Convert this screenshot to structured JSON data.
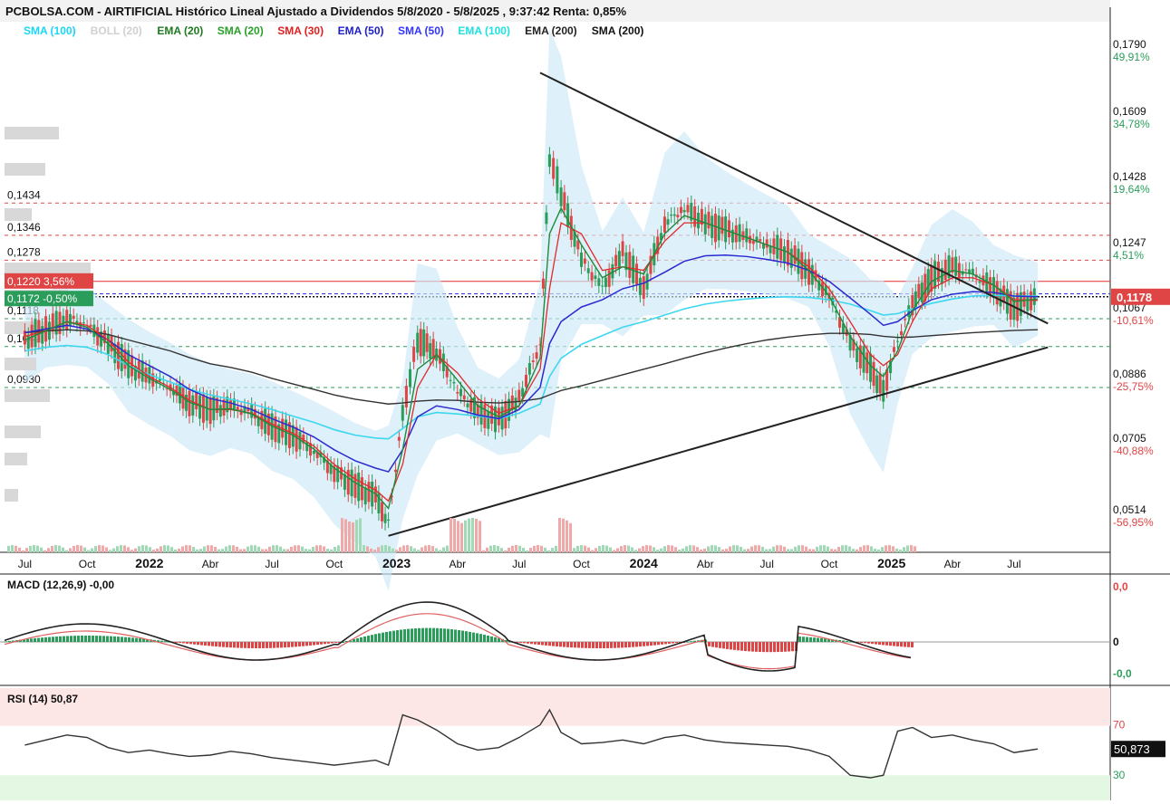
{
  "title": "PCBOLSA.COM - AIRTIFICIAL Histórico Lineal Ajustado a Dividendos 5/8/2020 - 5/8/2025 , 9:37:42 Renta: 0,85%",
  "legend": [
    {
      "label": "SMA (100)",
      "color": "#1ad7f7"
    },
    {
      "label": "BOLL (20)",
      "color": "#d0d0d0"
    },
    {
      "label": "EMA (20)",
      "color": "#1f7a1f"
    },
    {
      "label": "SMA (20)",
      "color": "#2aa02a"
    },
    {
      "label": "SMA (30)",
      "color": "#e02020"
    },
    {
      "label": "EMA (50)",
      "color": "#2020c8"
    },
    {
      "label": "SMA (50)",
      "color": "#3434ff"
    },
    {
      "label": "EMA (100)",
      "color": "#20e0e0"
    },
    {
      "label": "EMA (200)",
      "color": "#222222"
    },
    {
      "label": "SMA (200)",
      "color": "#111111"
    }
  ],
  "price_axis": [
    {
      "price": "0,1790",
      "pct": "49,91%",
      "pct_color": "#2a9d5a"
    },
    {
      "price": "0,1609",
      "pct": "34,78%",
      "pct_color": "#2a9d5a"
    },
    {
      "price": "0,1428",
      "pct": "19,64%",
      "pct_color": "#2a9d5a"
    },
    {
      "price": "0,1247",
      "pct": "4,51%",
      "pct_color": "#2a9d5a"
    },
    {
      "price": "0,1067",
      "pct": "-10,61%",
      "pct_color": "#e04545"
    },
    {
      "price": "0,0886",
      "pct": "-25,75%",
      "pct_color": "#e04545"
    },
    {
      "price": "0,0705",
      "pct": "-40,88%",
      "pct_color": "#e04545"
    },
    {
      "price": "0,0514",
      "pct": "-56,95%",
      "pct_color": "#e04545"
    }
  ],
  "current_price": "0,1178",
  "left_levels": [
    {
      "value": 0.1434,
      "text": "0,1434"
    },
    {
      "value": 0.1346,
      "text": "0,1346"
    },
    {
      "value": 0.1278,
      "text": "0,1278"
    },
    {
      "value": 0.1118,
      "text": "0,1118"
    },
    {
      "value": 0.1042,
      "text": "0,1042"
    },
    {
      "value": 0.093,
      "text": "0,0930"
    }
  ],
  "tag_high": {
    "value": 0.122,
    "text": "0,1220",
    "pct": "3,56%"
  },
  "tag_low": {
    "value": 0.1172,
    "text": "0,1172",
    "pct": "-0,50%"
  },
  "time_labels": [
    {
      "date": "2021-07-01",
      "text": "Jul",
      "bold": false
    },
    {
      "date": "2021-10-01",
      "text": "Oct",
      "bold": false
    },
    {
      "date": "2022-01-01",
      "text": "2022",
      "bold": true
    },
    {
      "date": "2022-04-01",
      "text": "Abr",
      "bold": false
    },
    {
      "date": "2022-07-01",
      "text": "Jul",
      "bold": false
    },
    {
      "date": "2022-10-01",
      "text": "Oct",
      "bold": false
    },
    {
      "date": "2023-01-01",
      "text": "2023",
      "bold": true
    },
    {
      "date": "2023-04-01",
      "text": "Abr",
      "bold": false
    },
    {
      "date": "2023-07-01",
      "text": "Jul",
      "bold": false
    },
    {
      "date": "2023-10-01",
      "text": "Oct",
      "bold": false
    },
    {
      "date": "2024-01-01",
      "text": "2024",
      "bold": true
    },
    {
      "date": "2024-04-01",
      "text": "Abr",
      "bold": false
    },
    {
      "date": "2024-07-01",
      "text": "Jul",
      "bold": false
    },
    {
      "date": "2024-10-01",
      "text": "Oct",
      "bold": false
    },
    {
      "date": "2025-01-01",
      "text": "2025",
      "bold": true
    },
    {
      "date": "2025-04-01",
      "text": "Abr",
      "bold": false
    },
    {
      "date": "2025-07-01",
      "text": "Jul",
      "bold": false
    }
  ],
  "macd": {
    "label": "MACD (12,26,9)",
    "value": "-0,00",
    "axis": [
      "0,0",
      "0",
      "-0,0"
    ]
  },
  "rsi": {
    "label": "RSI (14)",
    "value": "50,87",
    "current": "50,873",
    "axis": [
      "70",
      "30"
    ]
  },
  "chart_data": {
    "type": "line",
    "x_type": "date",
    "price": {
      "dates": [
        "2021-07-01",
        "2021-08-01",
        "2021-09-01",
        "2021-10-01",
        "2021-11-01",
        "2021-12-01",
        "2022-01-01",
        "2022-02-01",
        "2022-03-01",
        "2022-04-01",
        "2022-05-01",
        "2022-06-01",
        "2022-07-01",
        "2022-08-01",
        "2022-09-01",
        "2022-10-01",
        "2022-11-01",
        "2022-12-01",
        "2022-12-20",
        "2023-01-10",
        "2023-02-01",
        "2023-03-01",
        "2023-04-01",
        "2023-05-01",
        "2023-06-01",
        "2023-07-01",
        "2023-08-01",
        "2023-08-15",
        "2023-09-01",
        "2023-10-01",
        "2023-11-01",
        "2023-12-01",
        "2024-01-01",
        "2024-02-01",
        "2024-03-01",
        "2024-04-01",
        "2024-05-01",
        "2024-06-01",
        "2024-07-01",
        "2024-08-01",
        "2024-09-01",
        "2024-10-01",
        "2024-11-01",
        "2024-12-01",
        "2024-12-20",
        "2025-01-10",
        "2025-02-01",
        "2025-03-01",
        "2025-04-01",
        "2025-05-01",
        "2025-06-01",
        "2025-07-01",
        "2025-08-05"
      ],
      "close": [
        0.106,
        0.109,
        0.112,
        0.11,
        0.105,
        0.099,
        0.096,
        0.093,
        0.089,
        0.087,
        0.088,
        0.086,
        0.082,
        0.08,
        0.076,
        0.07,
        0.066,
        0.063,
        0.056,
        0.086,
        0.106,
        0.103,
        0.092,
        0.086,
        0.084,
        0.09,
        0.105,
        0.156,
        0.146,
        0.128,
        0.12,
        0.13,
        0.12,
        0.138,
        0.142,
        0.138,
        0.136,
        0.134,
        0.132,
        0.13,
        0.125,
        0.118,
        0.105,
        0.098,
        0.092,
        0.106,
        0.116,
        0.123,
        0.126,
        0.124,
        0.12,
        0.115,
        0.1178
      ]
    },
    "indicators": {
      "sma200": [
        0.108,
        0.1085,
        0.1088,
        0.1085,
        0.1075,
        0.106,
        0.1045,
        0.103,
        0.1012,
        0.0995,
        0.0985,
        0.0972,
        0.0955,
        0.094,
        0.0925,
        0.091,
        0.0898,
        0.089,
        0.0885,
        0.0888,
        0.0893,
        0.0896,
        0.0895,
        0.089,
        0.0888,
        0.0892,
        0.09,
        0.091,
        0.0922,
        0.0935,
        0.095,
        0.0965,
        0.098,
        0.0995,
        0.101,
        0.1025,
        0.1038,
        0.105,
        0.106,
        0.1068,
        0.1074,
        0.1078,
        0.1078,
        0.1075,
        0.107,
        0.1067,
        0.1068,
        0.1072,
        0.1076,
        0.108,
        0.1083,
        0.1086,
        0.1088
      ],
      "ema100": [
        0.103,
        0.104,
        0.1045,
        0.104,
        0.102,
        0.099,
        0.0965,
        0.0945,
        0.0925,
        0.091,
        0.0898,
        0.0885,
        0.087,
        0.0852,
        0.0835,
        0.0815,
        0.08,
        0.0792,
        0.079,
        0.0818,
        0.085,
        0.0862,
        0.0858,
        0.0852,
        0.0845,
        0.086,
        0.0885,
        0.096,
        0.101,
        0.1048,
        0.1072,
        0.1095,
        0.111,
        0.1128,
        0.1145,
        0.1158,
        0.1166,
        0.1172,
        0.1176,
        0.1178,
        0.1176,
        0.117,
        0.1158,
        0.114,
        0.1128,
        0.1132,
        0.1145,
        0.116,
        0.1172,
        0.118,
        0.1182,
        0.118,
        0.118
      ],
      "ema50": [
        0.108,
        0.109,
        0.11,
        0.109,
        0.106,
        0.102,
        0.099,
        0.096,
        0.0925,
        0.09,
        0.0888,
        0.087,
        0.0845,
        0.0822,
        0.0795,
        0.076,
        0.073,
        0.071,
        0.07,
        0.076,
        0.085,
        0.088,
        0.087,
        0.0855,
        0.0845,
        0.087,
        0.093,
        0.105,
        0.111,
        0.115,
        0.117,
        0.12,
        0.1215,
        0.1245,
        0.1275,
        0.129,
        0.1292,
        0.1288,
        0.128,
        0.127,
        0.125,
        0.122,
        0.1175,
        0.113,
        0.11,
        0.111,
        0.114,
        0.117,
        0.1185,
        0.1192,
        0.119,
        0.118,
        0.1178
      ],
      "sma30": [
        0.107,
        0.1085,
        0.111,
        0.11,
        0.106,
        0.1,
        0.096,
        0.093,
        0.0895,
        0.087,
        0.087,
        0.086,
        0.083,
        0.0805,
        0.077,
        0.072,
        0.068,
        0.065,
        0.062,
        0.072,
        0.093,
        0.102,
        0.097,
        0.09,
        0.086,
        0.088,
        0.098,
        0.12,
        0.138,
        0.135,
        0.125,
        0.126,
        0.125,
        0.133,
        0.138,
        0.138,
        0.136,
        0.134,
        0.132,
        0.13,
        0.126,
        0.12,
        0.111,
        0.102,
        0.099,
        0.102,
        0.111,
        0.12,
        0.123,
        0.123,
        0.121,
        0.117,
        0.1168
      ],
      "ema20": [
        0.106,
        0.1085,
        0.111,
        0.1095,
        0.105,
        0.099,
        0.0955,
        0.0925,
        0.089,
        0.087,
        0.0872,
        0.0858,
        0.0825,
        0.08,
        0.0762,
        0.071,
        0.067,
        0.064,
        0.06,
        0.076,
        0.098,
        0.102,
        0.095,
        0.088,
        0.085,
        0.088,
        0.101,
        0.135,
        0.142,
        0.132,
        0.123,
        0.126,
        0.124,
        0.135,
        0.14,
        0.138,
        0.136,
        0.134,
        0.132,
        0.13,
        0.125,
        0.118,
        0.107,
        0.099,
        0.096,
        0.103,
        0.114,
        0.122,
        0.125,
        0.124,
        0.121,
        0.1165,
        0.1172
      ]
    },
    "trendlines": [
      {
        "from": [
          "2023-08-01",
          0.179
        ],
        "to": [
          "2025-08-20",
          0.1105
        ]
      },
      {
        "from": [
          "2022-12-20",
          0.0525
        ],
        "to": [
          "2025-08-20",
          0.104
        ]
      }
    ],
    "macd_hist_sign": "mixed",
    "rsi_values": [
      54,
      58,
      62,
      60,
      52,
      48,
      50,
      47,
      45,
      46,
      49,
      47,
      44,
      42,
      40,
      38,
      40,
      42,
      38,
      78,
      74,
      66,
      55,
      50,
      52,
      60,
      70,
      82,
      64,
      55,
      56,
      58,
      55,
      60,
      62,
      58,
      56,
      55,
      54,
      53,
      50,
      45,
      30,
      28,
      30,
      65,
      68,
      60,
      62,
      58,
      55,
      48,
      50.873
    ],
    "ylim": [
      0.048,
      0.187
    ]
  }
}
